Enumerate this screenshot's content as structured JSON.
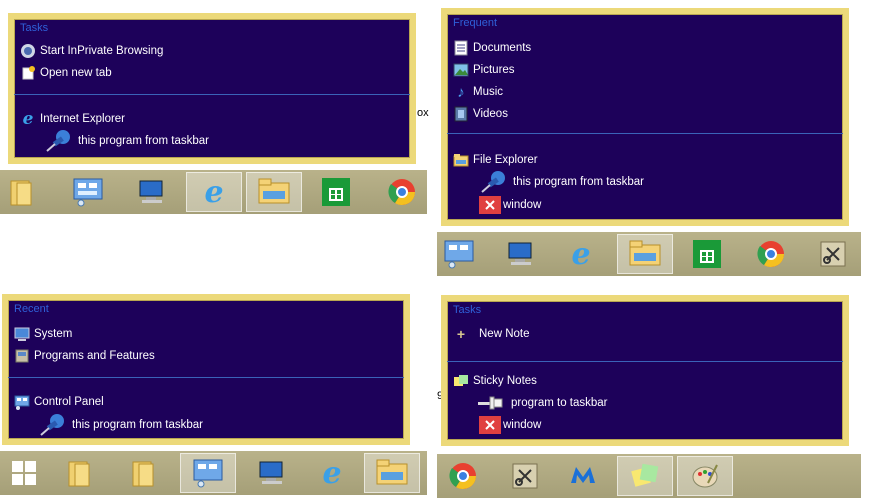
{
  "q1": {
    "header": "Tasks",
    "items": [
      "Start InPrivate Browsing",
      "Open new tab"
    ],
    "app": "Internet Explorer",
    "pin": "this program from taskbar"
  },
  "q2": {
    "header": "Frequent",
    "items": [
      "Documents",
      "Pictures",
      "Music",
      "Videos"
    ],
    "app": "File Explorer",
    "pin": "this program from taskbar",
    "close": "window",
    "stub": "ox"
  },
  "q3": {
    "header": "Recent",
    "items": [
      "System",
      "Programs and Features"
    ],
    "app": "Control Panel",
    "pin": "this program from taskbar"
  },
  "q4": {
    "header": "Tasks",
    "items": [
      "New Note"
    ],
    "app": "Sticky Notes",
    "pin": "program to taskbar",
    "close": "window",
    "stub": "9"
  },
  "icons": {
    "folder": "folder-icon",
    "control_panel": "control-panel-icon",
    "computer": "computer-icon",
    "ie": "internet-explorer-icon",
    "explorer": "file-explorer-icon",
    "store": "store-icon",
    "chrome": "chrome-icon",
    "snip": "snipping-tool-icon",
    "windows": "windows-logo-icon",
    "malwarebytes": "malwarebytes-icon",
    "sticky": "sticky-notes-icon",
    "paint": "paint-icon"
  },
  "colors": {
    "jumplist_bg": "#1d015a",
    "jumplist_border": "#ecd97a",
    "header_text": "#2f60d8",
    "item_text": "#ffffff",
    "taskbar": "#aea780"
  }
}
